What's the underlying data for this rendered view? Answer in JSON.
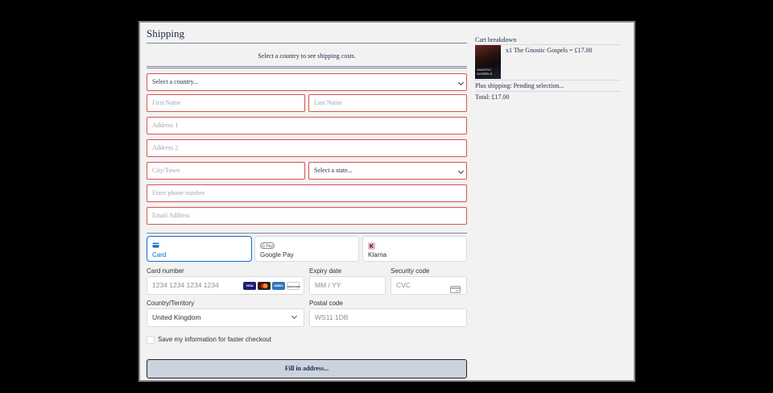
{
  "shipping": {
    "title": "Shipping",
    "notice": "Select a country to see shipping costs.",
    "country_select": "Select a country...",
    "first_name_ph": "First Name",
    "last_name_ph": "Last Name",
    "address1_ph": "Address 1",
    "address2_ph": "Address 2",
    "city_ph": "City/Town",
    "state_select": "Select a state...",
    "phone_ph": "Enter phone number",
    "email_ph": "Email Address"
  },
  "payment": {
    "tabs": [
      {
        "label": "Card",
        "icon": "card-icon"
      },
      {
        "label": "Google Pay",
        "icon": "google-pay-icon"
      },
      {
        "label": "Klarna",
        "icon": "klarna-icon"
      }
    ],
    "card_number_label": "Card number",
    "card_number_ph": "1234 1234 1234 1234",
    "expiry_label": "Expiry date",
    "expiry_ph": "MM / YY",
    "cvc_label": "Security code",
    "cvc_ph": "CVC",
    "country_label": "Country/Territory",
    "country_value": "United Kingdom",
    "postal_label": "Postal code",
    "postal_ph": "WS11 1DB",
    "brands": [
      "VISA",
      "MC",
      "AMEX",
      "DISCOVER"
    ],
    "save_label": "Save my information for faster checkout"
  },
  "fill_button": "Fill in address...",
  "cart": {
    "heading": "Cart breakdown",
    "item": "x1 The Gnostic Gospels = £17.00",
    "cover_text": "GNOSTIC GOSPELS",
    "shipping": "Plus shipping: Pending selection...",
    "total": "Total: £17.00"
  },
  "colors": {
    "accent": "#0a6cd6",
    "error_border": "#d9534f",
    "button_bg": "#cbd3de"
  }
}
